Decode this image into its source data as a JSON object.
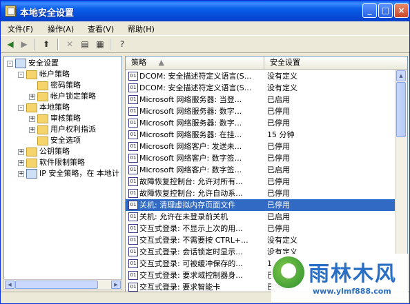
{
  "window": {
    "title": "本地安全设置"
  },
  "menu": [
    "文件(F)",
    "操作(A)",
    "查看(V)",
    "帮助(H)"
  ],
  "toolbar": [
    "back-icon",
    "forward-icon",
    "up-folder-icon",
    "delete-icon",
    "properties-icon",
    "export-icon",
    "help-icon"
  ],
  "tree": [
    {
      "label": "安全设置",
      "level": 0,
      "expander": "-",
      "icon": "pc"
    },
    {
      "label": "帐户策略",
      "level": 1,
      "expander": "-",
      "icon": "folder"
    },
    {
      "label": "密码策略",
      "level": 2,
      "expander": "",
      "icon": "folder"
    },
    {
      "label": "帐户锁定策略",
      "level": 2,
      "expander": "+",
      "icon": "folder"
    },
    {
      "label": "本地策略",
      "level": 1,
      "expander": "-",
      "icon": "folder"
    },
    {
      "label": "审核策略",
      "level": 2,
      "expander": "+",
      "icon": "folder"
    },
    {
      "label": "用户权利指派",
      "level": 2,
      "expander": "+",
      "icon": "folder"
    },
    {
      "label": "安全选项",
      "level": 2,
      "expander": "",
      "icon": "folder"
    },
    {
      "label": "公钥策略",
      "level": 1,
      "expander": "+",
      "icon": "folder"
    },
    {
      "label": "软件限制策略",
      "level": 1,
      "expander": "+",
      "icon": "folder"
    },
    {
      "label": "IP 安全策略，在 本地计",
      "level": 1,
      "expander": "+",
      "icon": "pc"
    }
  ],
  "list": {
    "columns": [
      "策略",
      "安全设置"
    ],
    "rows": [
      {
        "policy": "DCOM: 安全描述符定义语言(S...",
        "setting": "没有定义"
      },
      {
        "policy": "DCOM: 安全描述符定义语言(S...",
        "setting": "没有定义"
      },
      {
        "policy": "Microsoft 网络服务器: 当登...",
        "setting": "已启用"
      },
      {
        "policy": "Microsoft 网络服务器: 数字...",
        "setting": "已停用"
      },
      {
        "policy": "Microsoft 网络服务器: 数字...",
        "setting": "已停用"
      },
      {
        "policy": "Microsoft 网络服务器: 在挂...",
        "setting": "15 分钟"
      },
      {
        "policy": "Microsoft 网络客户: 发送未...",
        "setting": "已停用"
      },
      {
        "policy": "Microsoft 网络客户: 数字签...",
        "setting": "已停用"
      },
      {
        "policy": "Microsoft 网络客户: 数字签...",
        "setting": "已启用"
      },
      {
        "policy": "故障恢复控制台: 允许对所有...",
        "setting": "已停用"
      },
      {
        "policy": "故障恢复控制台: 允许自动系...",
        "setting": "已停用"
      },
      {
        "policy": "关机: 清理虚拟内存页面文件",
        "setting": "已停用",
        "selected": true
      },
      {
        "policy": "关机: 允许在未登录前关机",
        "setting": "已启用"
      },
      {
        "policy": "交互式登录: 不显示上次的用...",
        "setting": "已停用"
      },
      {
        "policy": "交互式登录: 不需要按 CTRL+...",
        "setting": "没有定义"
      },
      {
        "policy": "交互式登录: 会话锁定时显示...",
        "setting": "没有定义"
      },
      {
        "policy": "交互式登录: 可被缓冲保存的...",
        "setting": "10 登录"
      },
      {
        "policy": "交互式登录: 要求域控制器身...",
        "setting": "已停用"
      },
      {
        "policy": "交互式登录: 要求智能卡",
        "setting": "已停用"
      }
    ]
  },
  "watermark": {
    "text": "雨林木风",
    "url": "www.ylmf888.com"
  },
  "colors": {
    "titlebar": "#0a5ee8",
    "selection": "#316ac5"
  }
}
